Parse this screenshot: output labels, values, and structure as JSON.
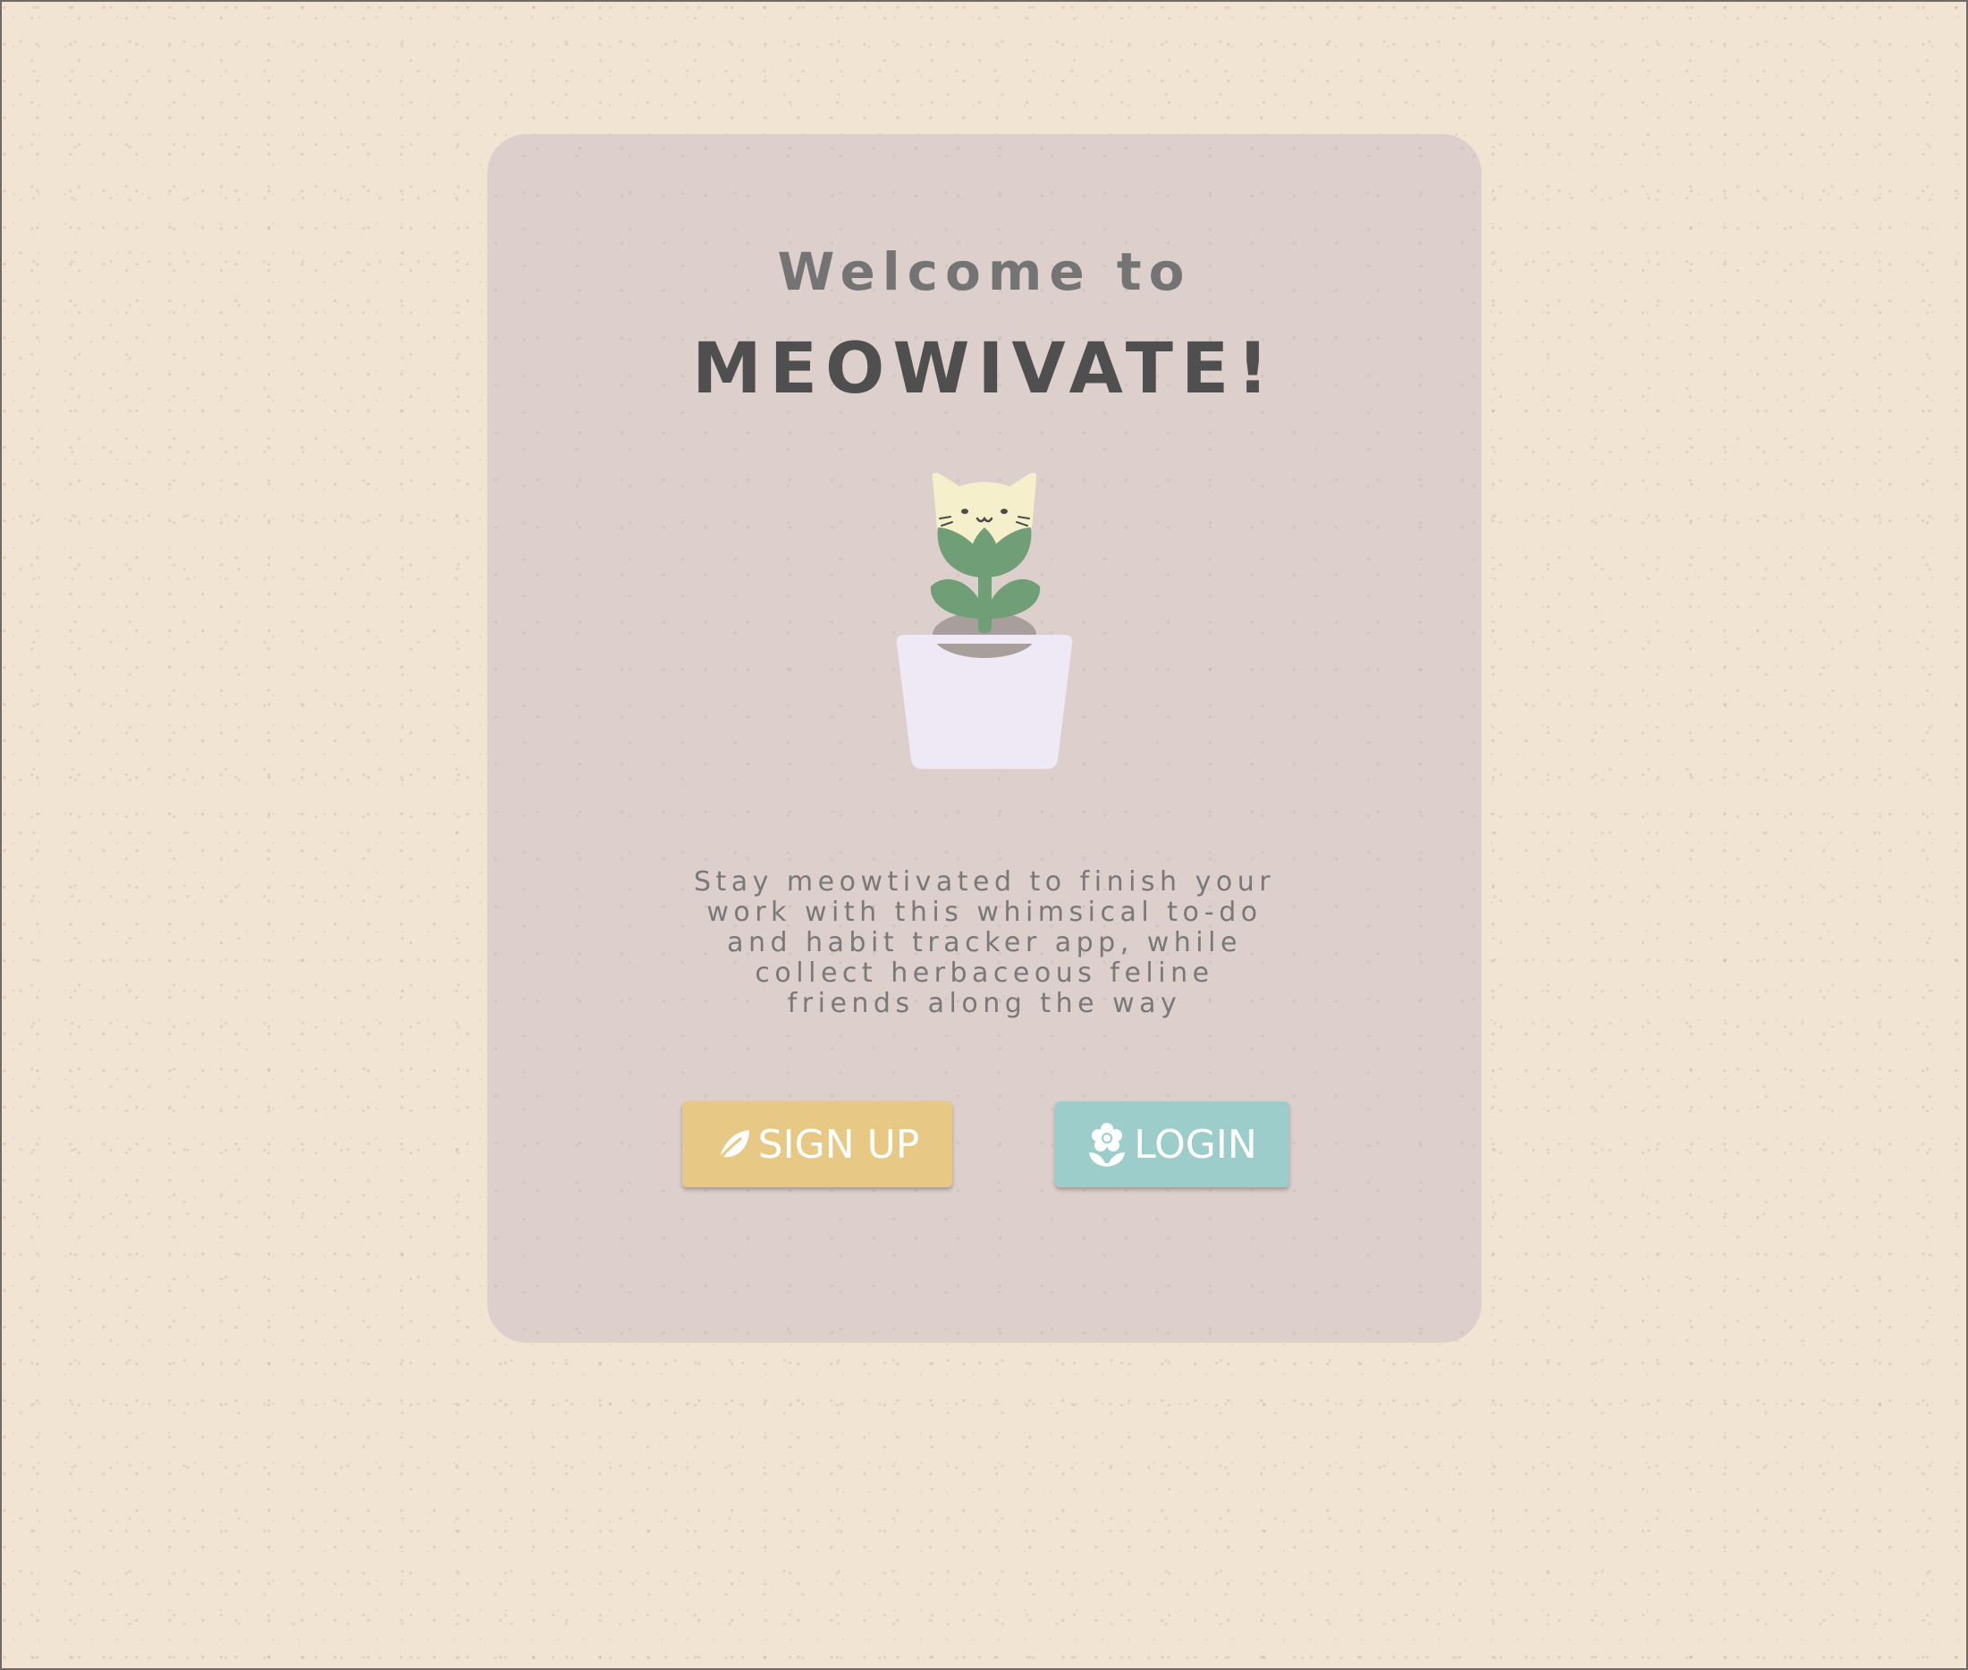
{
  "welcome": {
    "heading": "Welcome to",
    "app_name": "MEOWIVATE!",
    "tagline_lines": [
      "Stay meowtivated to finish your",
      "work with this whimsical to-do",
      "and habit tracker app, while",
      "collect herbaceous feline",
      "friends along the way"
    ]
  },
  "illustration": {
    "name": "potted cat-flower plant"
  },
  "buttons": {
    "signup": {
      "label": "SIGN UP",
      "icon": "leaf-icon",
      "color": "#e7c985"
    },
    "login": {
      "label": "LOGIN",
      "icon": "flower-icon",
      "color": "#9dcdca"
    }
  },
  "colors": {
    "background": "#f1e4d3",
    "card": "#ddcfcb",
    "heading": "#747474",
    "title": "#4f4f4f",
    "text": "#7a7878"
  }
}
